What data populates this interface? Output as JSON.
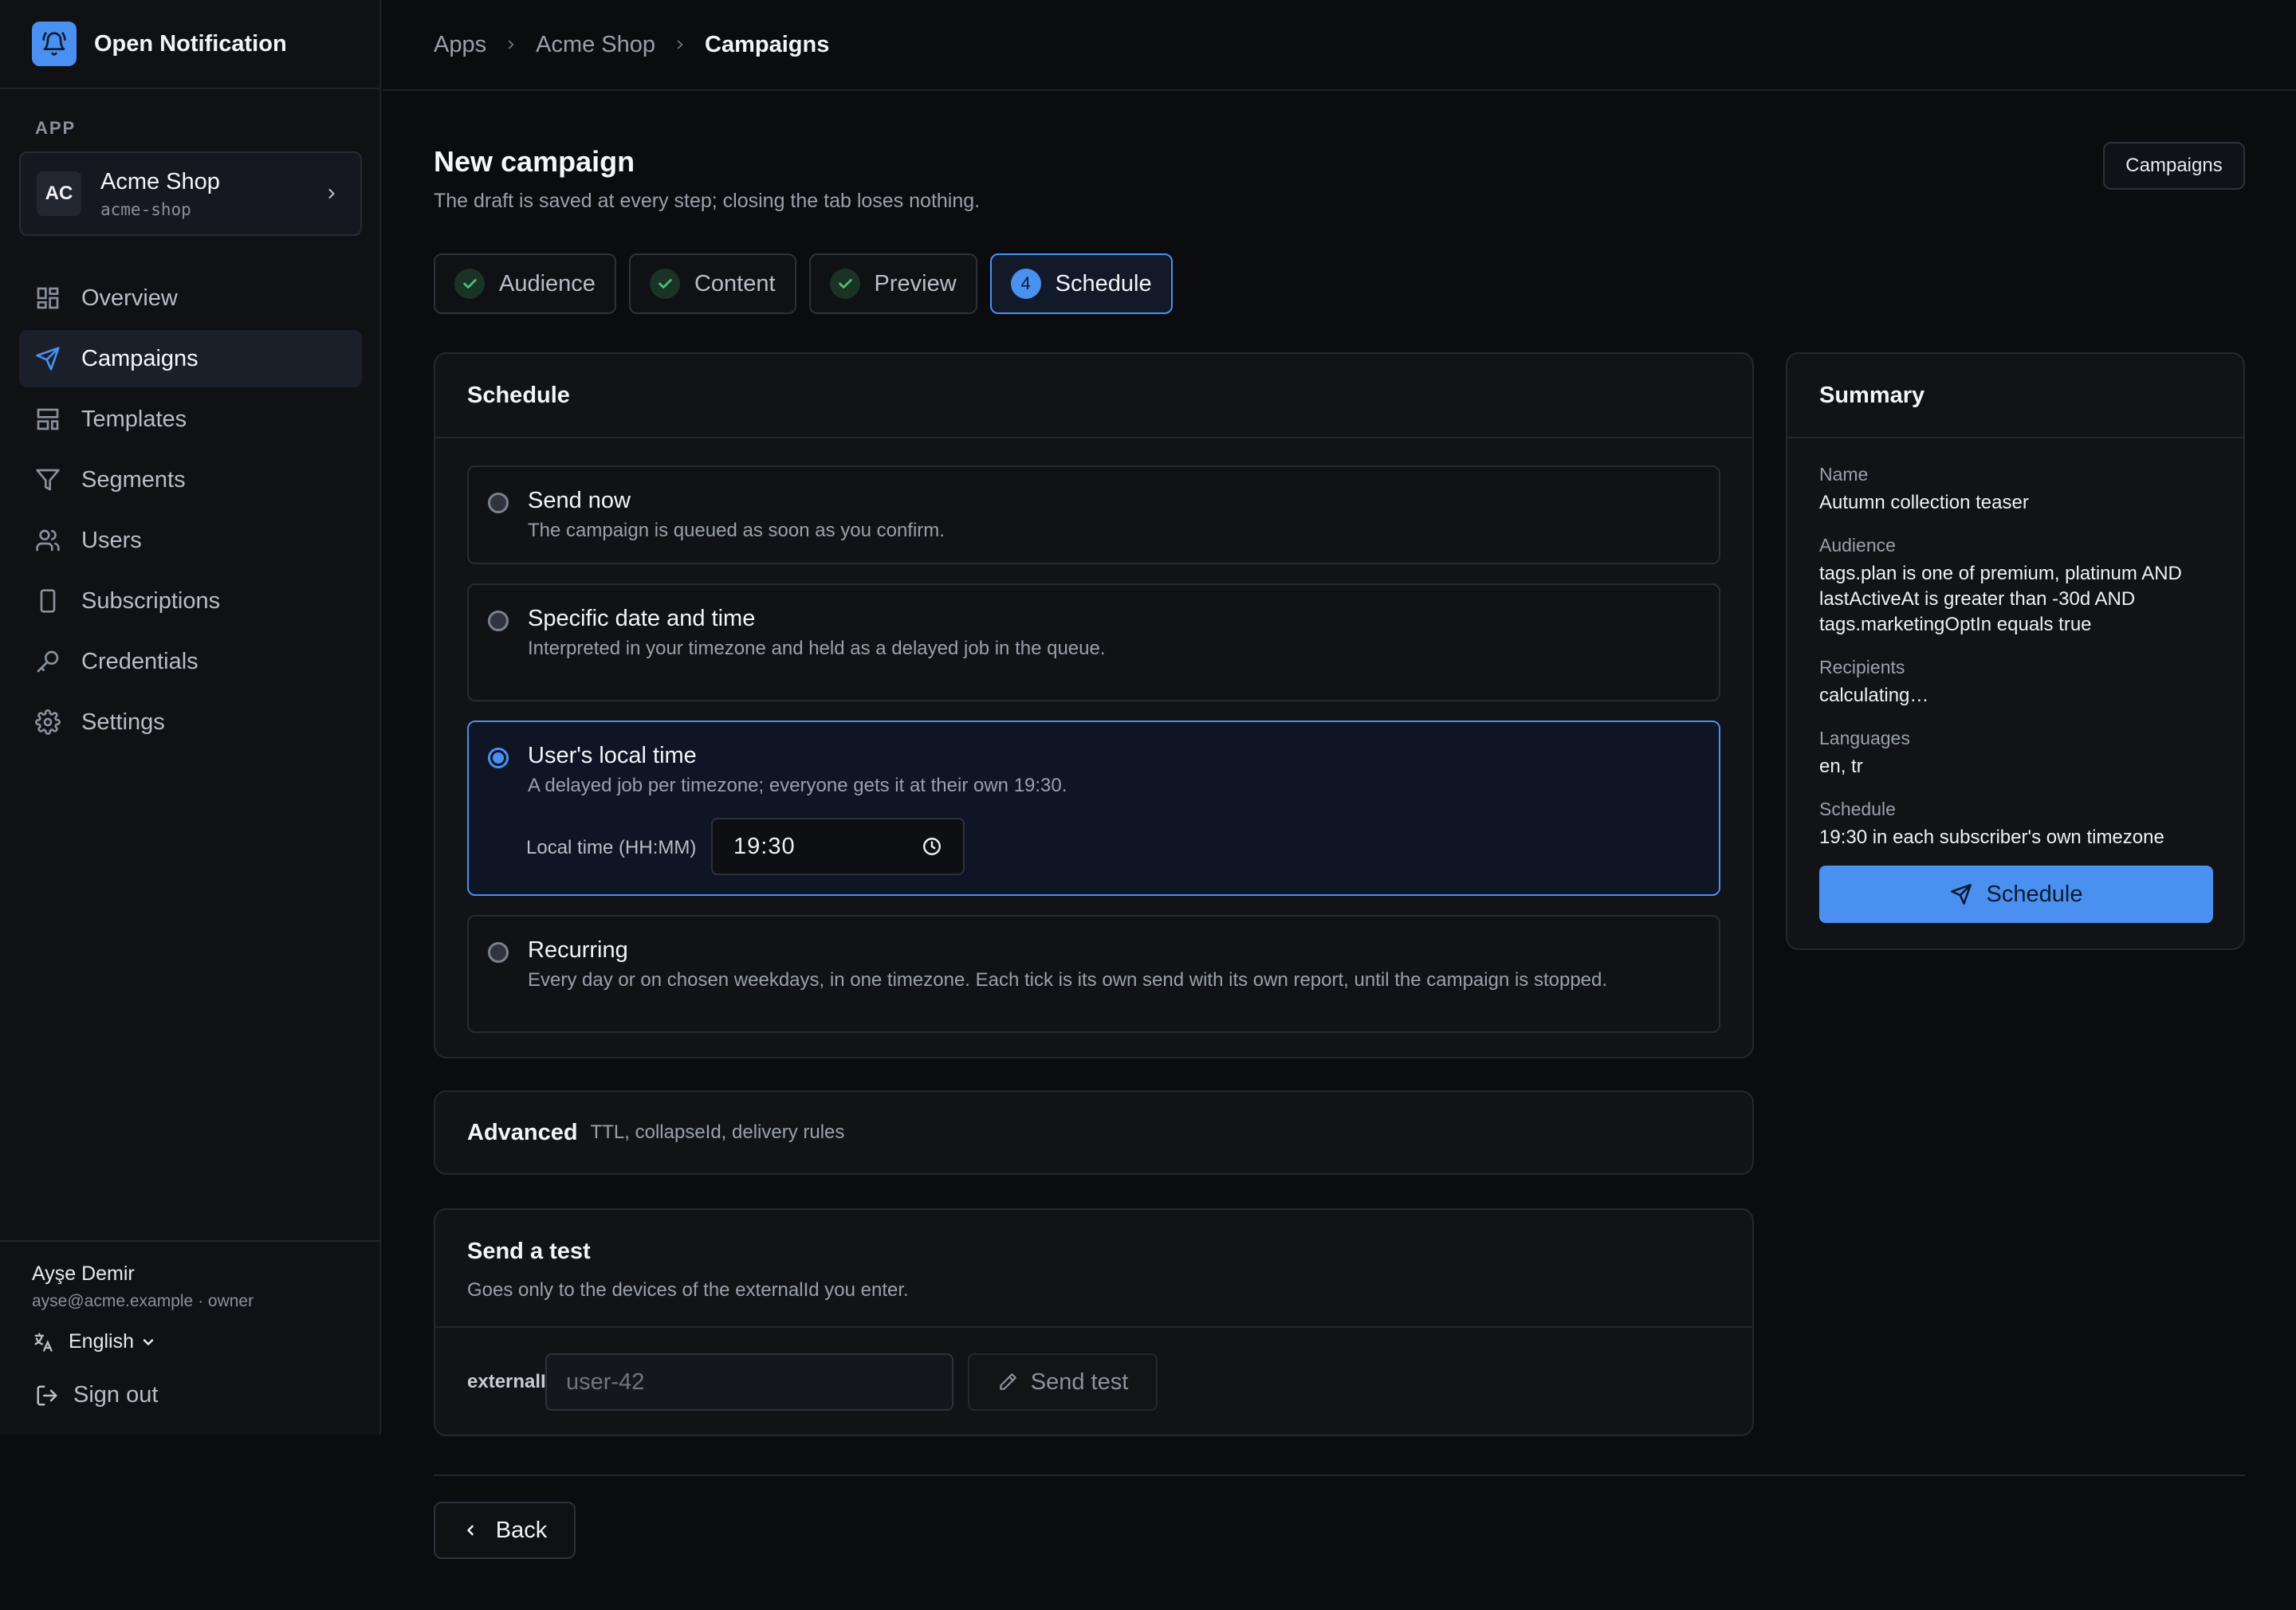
{
  "brand": {
    "name": "Open Notification",
    "accent": "#4a90f0"
  },
  "sidebar": {
    "section_label": "APP",
    "app": {
      "initials": "AC",
      "name": "Acme Shop",
      "slug": "acme-shop"
    },
    "items": [
      {
        "label": "Overview",
        "icon": "layout-grid-icon",
        "active": false
      },
      {
        "label": "Campaigns",
        "icon": "send-icon",
        "active": true
      },
      {
        "label": "Templates",
        "icon": "template-icon",
        "active": false
      },
      {
        "label": "Segments",
        "icon": "filter-icon",
        "active": false
      },
      {
        "label": "Users",
        "icon": "users-icon",
        "active": false
      },
      {
        "label": "Subscriptions",
        "icon": "device-icon",
        "active": false
      },
      {
        "label": "Credentials",
        "icon": "key-icon",
        "active": false
      },
      {
        "label": "Settings",
        "icon": "gear-icon",
        "active": false
      }
    ],
    "user": {
      "name": "Ayşe Demir",
      "meta": "ayse@acme.example · owner"
    },
    "language": "English",
    "sign_out": "Sign out"
  },
  "breadcrumb": [
    "Apps",
    "Acme Shop",
    "Campaigns"
  ],
  "page": {
    "title": "New campaign",
    "subtitle": "The draft is saved at every step; closing the tab loses nothing.",
    "campaigns_button": "Campaigns"
  },
  "steps": [
    {
      "label": "Audience",
      "state": "done"
    },
    {
      "label": "Content",
      "state": "done"
    },
    {
      "label": "Preview",
      "state": "done"
    },
    {
      "number": "4",
      "label": "Schedule",
      "state": "active"
    }
  ],
  "schedule": {
    "heading": "Schedule",
    "options": [
      {
        "title": "Send now",
        "desc": "The campaign is queued as soon as you confirm.",
        "selected": false
      },
      {
        "title": "Specific date and time",
        "desc": "Interpreted in your timezone and held as a delayed job in the queue.",
        "selected": false
      },
      {
        "title": "User's local time",
        "desc": "A delayed job per timezone; everyone gets it at their own 19:30.",
        "selected": true
      },
      {
        "title": "Recurring",
        "desc": "Every day or on chosen weekdays, in one timezone. Each tick is its own send with its own report, until the campaign is stopped.",
        "selected": false
      }
    ],
    "local_time_label": "Local time (HH:MM)",
    "local_time_value": "19:30"
  },
  "advanced": {
    "title": "Advanced",
    "hint": "TTL, collapseId, delivery rules"
  },
  "test": {
    "title": "Send a test",
    "desc": "Goes only to the devices of the externalId you enter.",
    "field_label": "externalId",
    "placeholder": "user-42",
    "button": "Send test"
  },
  "summary": {
    "heading": "Summary",
    "rows": [
      {
        "label": "Name",
        "value": "Autumn collection teaser"
      },
      {
        "label": "Audience",
        "value": "tags.plan is one of premium, platinum AND lastActiveAt is greater than -30d AND tags.marketingOptIn equals true"
      },
      {
        "label": "Recipients",
        "value": "calculating…"
      },
      {
        "label": "Languages",
        "value": "en, tr"
      },
      {
        "label": "Schedule",
        "value": "19:30 in each subscriber's own timezone"
      }
    ],
    "button": "Schedule"
  },
  "footer": {
    "back": "Back"
  }
}
